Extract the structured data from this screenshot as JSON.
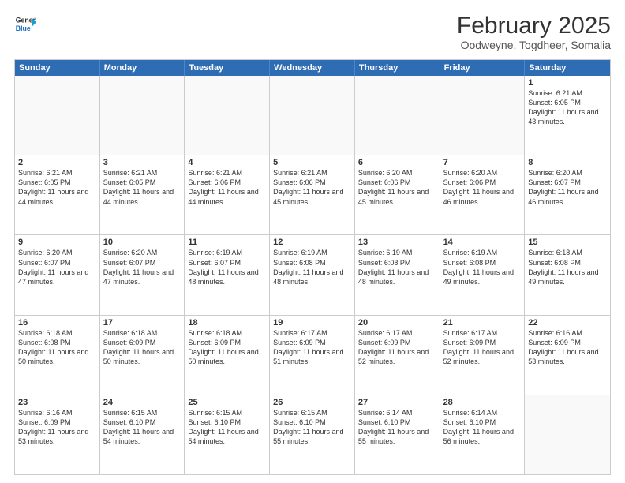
{
  "header": {
    "logo_line1": "General",
    "logo_line2": "Blue",
    "title": "February 2025",
    "subtitle": "Oodweyne, Togdheer, Somalia"
  },
  "days_of_week": [
    "Sunday",
    "Monday",
    "Tuesday",
    "Wednesday",
    "Thursday",
    "Friday",
    "Saturday"
  ],
  "weeks": [
    [
      {
        "day": "",
        "empty": true
      },
      {
        "day": "",
        "empty": true
      },
      {
        "day": "",
        "empty": true
      },
      {
        "day": "",
        "empty": true
      },
      {
        "day": "",
        "empty": true
      },
      {
        "day": "",
        "empty": true
      },
      {
        "day": "1",
        "sunrise": "6:21 AM",
        "sunset": "6:05 PM",
        "daylight": "11 hours and 43 minutes."
      }
    ],
    [
      {
        "day": "2",
        "sunrise": "6:21 AM",
        "sunset": "6:05 PM",
        "daylight": "11 hours and 44 minutes."
      },
      {
        "day": "3",
        "sunrise": "6:21 AM",
        "sunset": "6:05 PM",
        "daylight": "11 hours and 44 minutes."
      },
      {
        "day": "4",
        "sunrise": "6:21 AM",
        "sunset": "6:06 PM",
        "daylight": "11 hours and 44 minutes."
      },
      {
        "day": "5",
        "sunrise": "6:21 AM",
        "sunset": "6:06 PM",
        "daylight": "11 hours and 45 minutes."
      },
      {
        "day": "6",
        "sunrise": "6:20 AM",
        "sunset": "6:06 PM",
        "daylight": "11 hours and 45 minutes."
      },
      {
        "day": "7",
        "sunrise": "6:20 AM",
        "sunset": "6:06 PM",
        "daylight": "11 hours and 46 minutes."
      },
      {
        "day": "8",
        "sunrise": "6:20 AM",
        "sunset": "6:07 PM",
        "daylight": "11 hours and 46 minutes."
      }
    ],
    [
      {
        "day": "9",
        "sunrise": "6:20 AM",
        "sunset": "6:07 PM",
        "daylight": "11 hours and 47 minutes."
      },
      {
        "day": "10",
        "sunrise": "6:20 AM",
        "sunset": "6:07 PM",
        "daylight": "11 hours and 47 minutes."
      },
      {
        "day": "11",
        "sunrise": "6:19 AM",
        "sunset": "6:07 PM",
        "daylight": "11 hours and 48 minutes."
      },
      {
        "day": "12",
        "sunrise": "6:19 AM",
        "sunset": "6:08 PM",
        "daylight": "11 hours and 48 minutes."
      },
      {
        "day": "13",
        "sunrise": "6:19 AM",
        "sunset": "6:08 PM",
        "daylight": "11 hours and 48 minutes."
      },
      {
        "day": "14",
        "sunrise": "6:19 AM",
        "sunset": "6:08 PM",
        "daylight": "11 hours and 49 minutes."
      },
      {
        "day": "15",
        "sunrise": "6:18 AM",
        "sunset": "6:08 PM",
        "daylight": "11 hours and 49 minutes."
      }
    ],
    [
      {
        "day": "16",
        "sunrise": "6:18 AM",
        "sunset": "6:08 PM",
        "daylight": "11 hours and 50 minutes."
      },
      {
        "day": "17",
        "sunrise": "6:18 AM",
        "sunset": "6:09 PM",
        "daylight": "11 hours and 50 minutes."
      },
      {
        "day": "18",
        "sunrise": "6:18 AM",
        "sunset": "6:09 PM",
        "daylight": "11 hours and 50 minutes."
      },
      {
        "day": "19",
        "sunrise": "6:17 AM",
        "sunset": "6:09 PM",
        "daylight": "11 hours and 51 minutes."
      },
      {
        "day": "20",
        "sunrise": "6:17 AM",
        "sunset": "6:09 PM",
        "daylight": "11 hours and 52 minutes."
      },
      {
        "day": "21",
        "sunrise": "6:17 AM",
        "sunset": "6:09 PM",
        "daylight": "11 hours and 52 minutes."
      },
      {
        "day": "22",
        "sunrise": "6:16 AM",
        "sunset": "6:09 PM",
        "daylight": "11 hours and 53 minutes."
      }
    ],
    [
      {
        "day": "23",
        "sunrise": "6:16 AM",
        "sunset": "6:09 PM",
        "daylight": "11 hours and 53 minutes."
      },
      {
        "day": "24",
        "sunrise": "6:15 AM",
        "sunset": "6:10 PM",
        "daylight": "11 hours and 54 minutes."
      },
      {
        "day": "25",
        "sunrise": "6:15 AM",
        "sunset": "6:10 PM",
        "daylight": "11 hours and 54 minutes."
      },
      {
        "day": "26",
        "sunrise": "6:15 AM",
        "sunset": "6:10 PM",
        "daylight": "11 hours and 55 minutes."
      },
      {
        "day": "27",
        "sunrise": "6:14 AM",
        "sunset": "6:10 PM",
        "daylight": "11 hours and 55 minutes."
      },
      {
        "day": "28",
        "sunrise": "6:14 AM",
        "sunset": "6:10 PM",
        "daylight": "11 hours and 56 minutes."
      },
      {
        "day": "",
        "empty": true
      }
    ]
  ]
}
